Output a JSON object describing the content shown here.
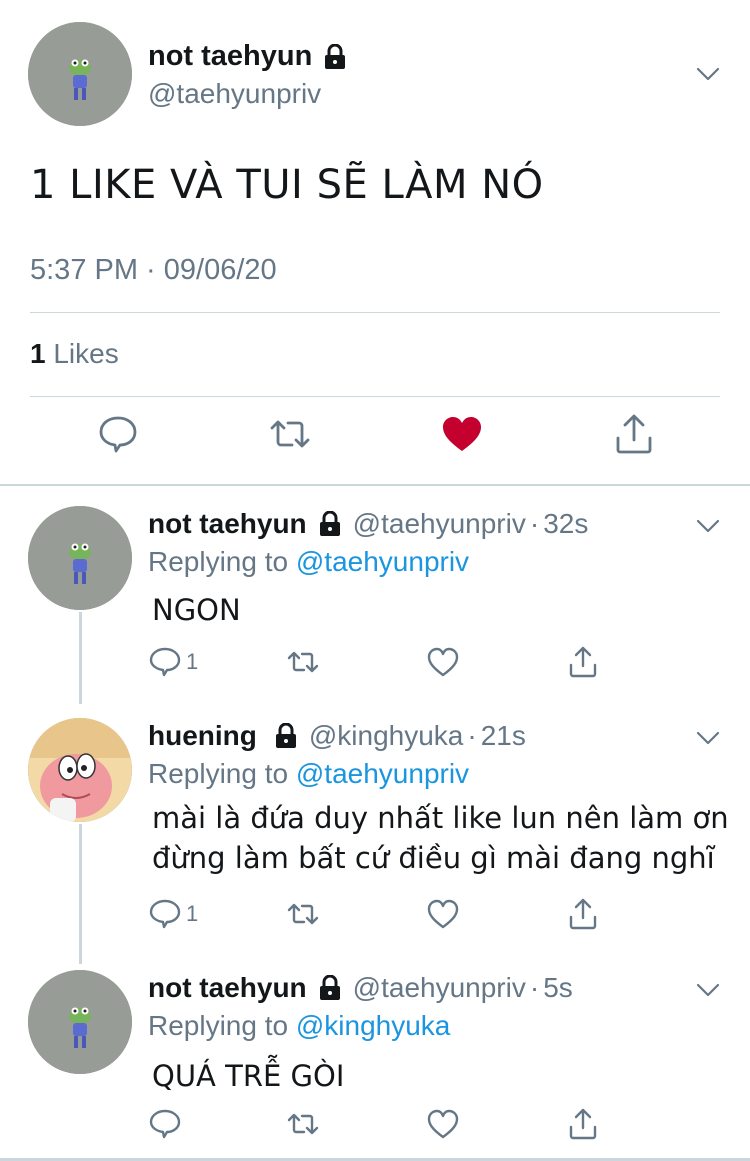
{
  "main_tweet": {
    "display_name": "not taehyun",
    "handle": "@taehyunpriv",
    "text": "1 LIKE VÀ TUI SẼ LÀM NÓ",
    "timestamp": "5:37 PM · 09/06/20",
    "like_count": "1",
    "likes_label": "Likes"
  },
  "replies": [
    {
      "display_name": "not taehyun",
      "handle": "@taehyunpriv",
      "separator": "·",
      "time": "32s",
      "replying_prefix": "Replying to",
      "replying_to": "@taehyunpriv",
      "text": "NGON",
      "reply_count": "1"
    },
    {
      "display_name": "huening",
      "handle": "@kinghyuka",
      "separator": "·",
      "time": "21s",
      "replying_prefix": "Replying to",
      "replying_to": "@taehyunpriv",
      "text_line1": "mài là đứa duy nhất like lun nên làm ơn",
      "text_line2": "đừng làm bất cứ điều gì mài đang nghĩ",
      "reply_count": "1"
    },
    {
      "display_name": "not taehyun",
      "handle": "@taehyunpriv",
      "separator": "·",
      "time": "5s",
      "replying_prefix": "Replying to",
      "replying_to": "@kinghyuka",
      "text": "QUÁ TRỄ GÒI"
    }
  ],
  "colors": {
    "text": "#14171a",
    "secondary": "#657786",
    "link": "#1b95e0",
    "liked_heart": "#c4002f",
    "divider": "#ccd6dd"
  },
  "icons": [
    "lock-icon",
    "chevron-down-icon",
    "reply-icon",
    "retweet-icon",
    "heart-icon",
    "share-icon"
  ]
}
